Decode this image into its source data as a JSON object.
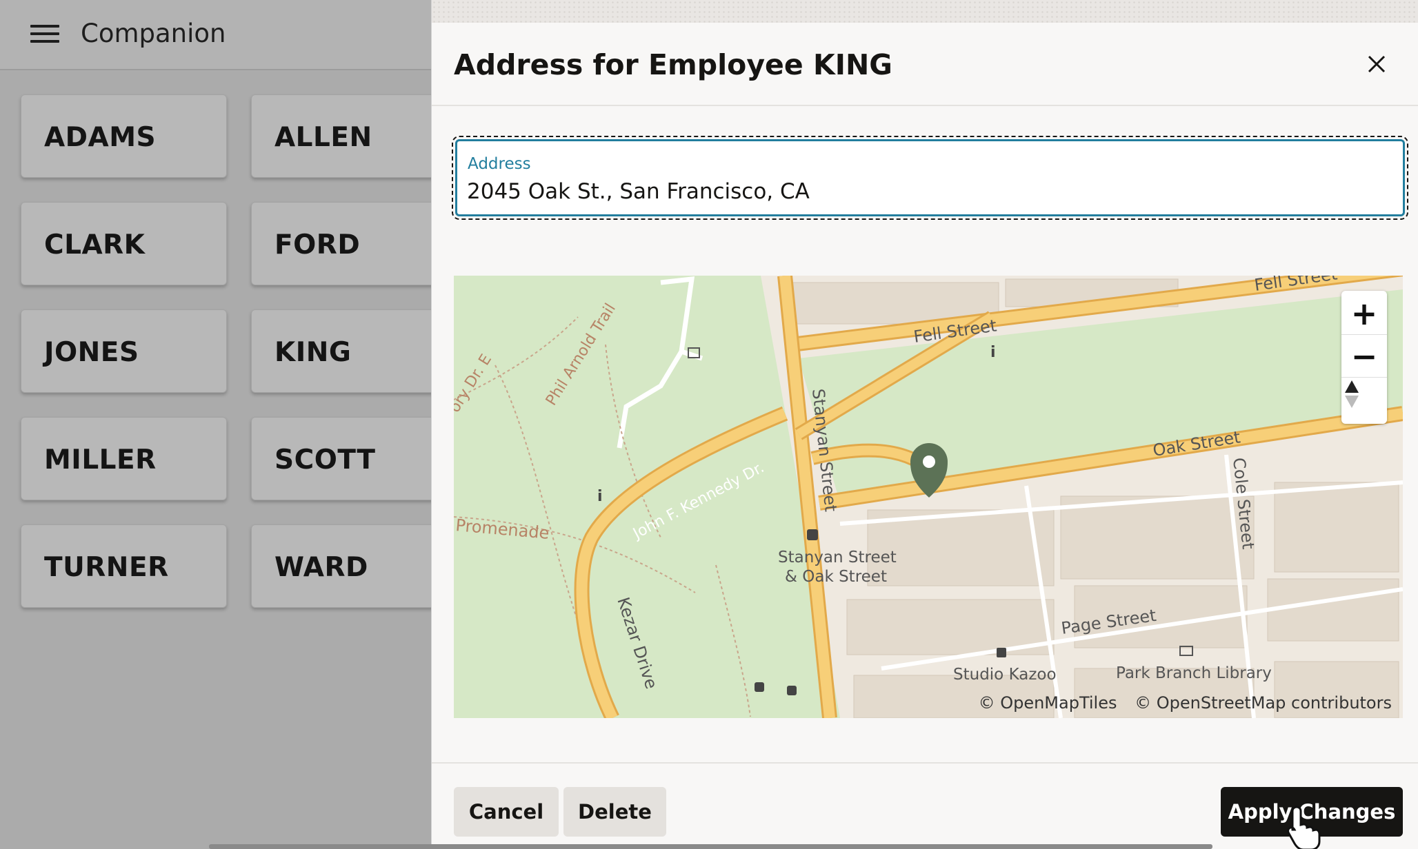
{
  "app": {
    "title": "Companion",
    "employees": [
      "ADAMS",
      "ALLEN",
      "CLARK",
      "FORD",
      "JONES",
      "KING",
      "MILLER",
      "SCOTT",
      "TURNER",
      "WARD"
    ]
  },
  "dialog": {
    "title": "Address for Employee KING",
    "address_label": "Address",
    "address_value": "2045 Oak St., San Francisco, CA",
    "cancel_label": "Cancel",
    "delete_label": "Delete",
    "apply_label": "Apply Changes"
  },
  "map": {
    "zoom_in": "+",
    "zoom_out": "−",
    "labels": {
      "fell_top": "Fell Street",
      "fell": "Fell Street",
      "oak": "Oak Street",
      "stanyan": "Stanyan Street",
      "cole": "Cole Street",
      "page": "Page Street",
      "kennedy": "John F. Kennedy Dr.",
      "kezar": "Kezar Drive",
      "promenade": "Promenade",
      "phil": "Phil Arnold Trail",
      "drE": "ory Dr. E",
      "stop": "Stanyan Street",
      "stop2": "& Oak Street",
      "kazoo": "Studio Kazoo",
      "library": "Park Branch Library"
    },
    "attribution": [
      "© OpenMapTiles",
      "© OpenStreetMap contributors"
    ],
    "colors": {
      "park": "#d6e8c6",
      "road": "#f7cf78",
      "road_edge": "#e2a94a",
      "marker": "#5c7256",
      "urban": "#efe9e0"
    }
  }
}
